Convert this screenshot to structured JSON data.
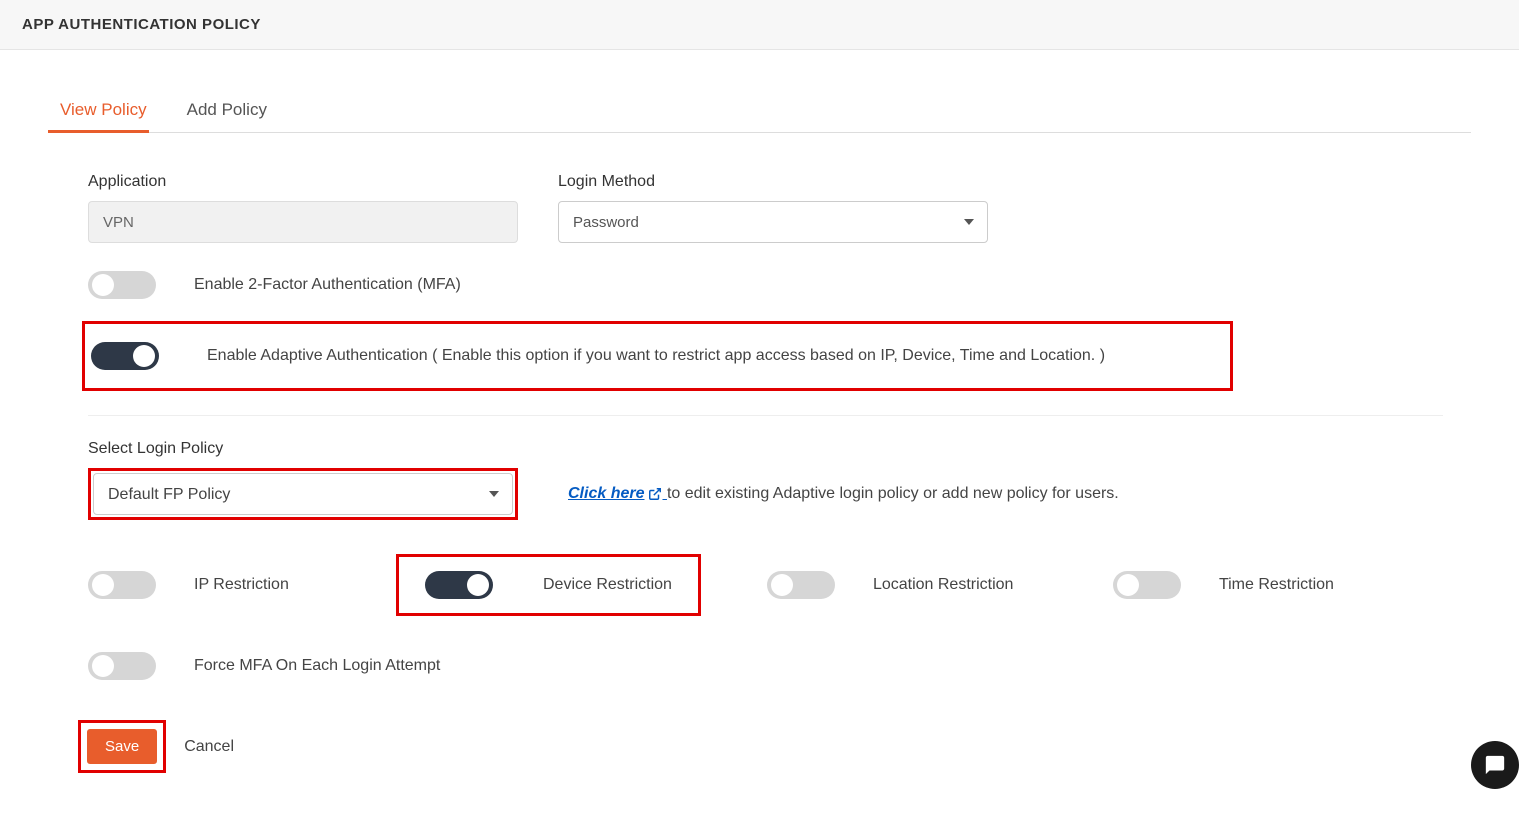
{
  "header": {
    "title": "APP AUTHENTICATION POLICY"
  },
  "tabs": {
    "view": "View Policy",
    "add": "Add Policy"
  },
  "form": {
    "application_label": "Application",
    "application_value": "VPN",
    "login_method_label": "Login Method",
    "login_method_value": "Password",
    "mfa_label": "Enable 2-Factor Authentication (MFA)",
    "adaptive_label": "Enable Adaptive Authentication ( Enable this option if you want to restrict app access based on IP, Device, Time and Location. )",
    "select_login_policy_label": "Select Login Policy",
    "login_policy_value": "Default FP Policy",
    "click_here_text": "Click here",
    "click_here_suffix": " to edit existing Adaptive login policy or add new policy for users.",
    "restrictions": {
      "ip": "IP Restriction",
      "device": "Device Restriction",
      "location": "Location Restriction",
      "time": "Time Restriction"
    },
    "force_mfa_label": "Force MFA On Each Login Attempt",
    "save": "Save",
    "cancel": "Cancel"
  }
}
